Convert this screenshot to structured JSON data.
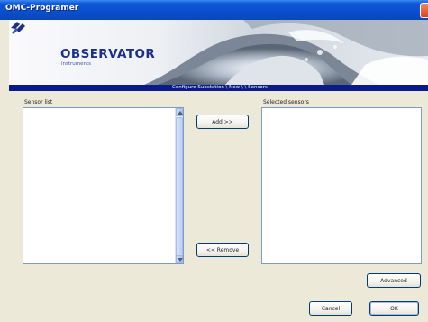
{
  "window": {
    "title": "OMC-Programer"
  },
  "banner": {
    "logo_text": "OBSERVATOR",
    "logo_subtext": "instruments",
    "breadcrumb": "Configure Substation \\ New \\ \\ Sensors"
  },
  "sensor_list": {
    "label": "Sensor list",
    "items": []
  },
  "selected_sensors": {
    "label": "Selected sensors",
    "items": []
  },
  "buttons": {
    "add": "Add >>",
    "remove": "<< Remove",
    "advanced": "Advanced",
    "cancel": "Cancel",
    "ok": "OK"
  },
  "icons": {
    "close": "close-icon",
    "logo": "observator-logo-icon",
    "scroll_up": "arrow-up-icon",
    "scroll_down": "arrow-down-icon"
  },
  "colors": {
    "titlebar": "#0a4fd0",
    "breadcrumb_bar": "#0a1a8a",
    "logo": "#1c2f8c",
    "dialog_bg": "#ece9d8"
  }
}
